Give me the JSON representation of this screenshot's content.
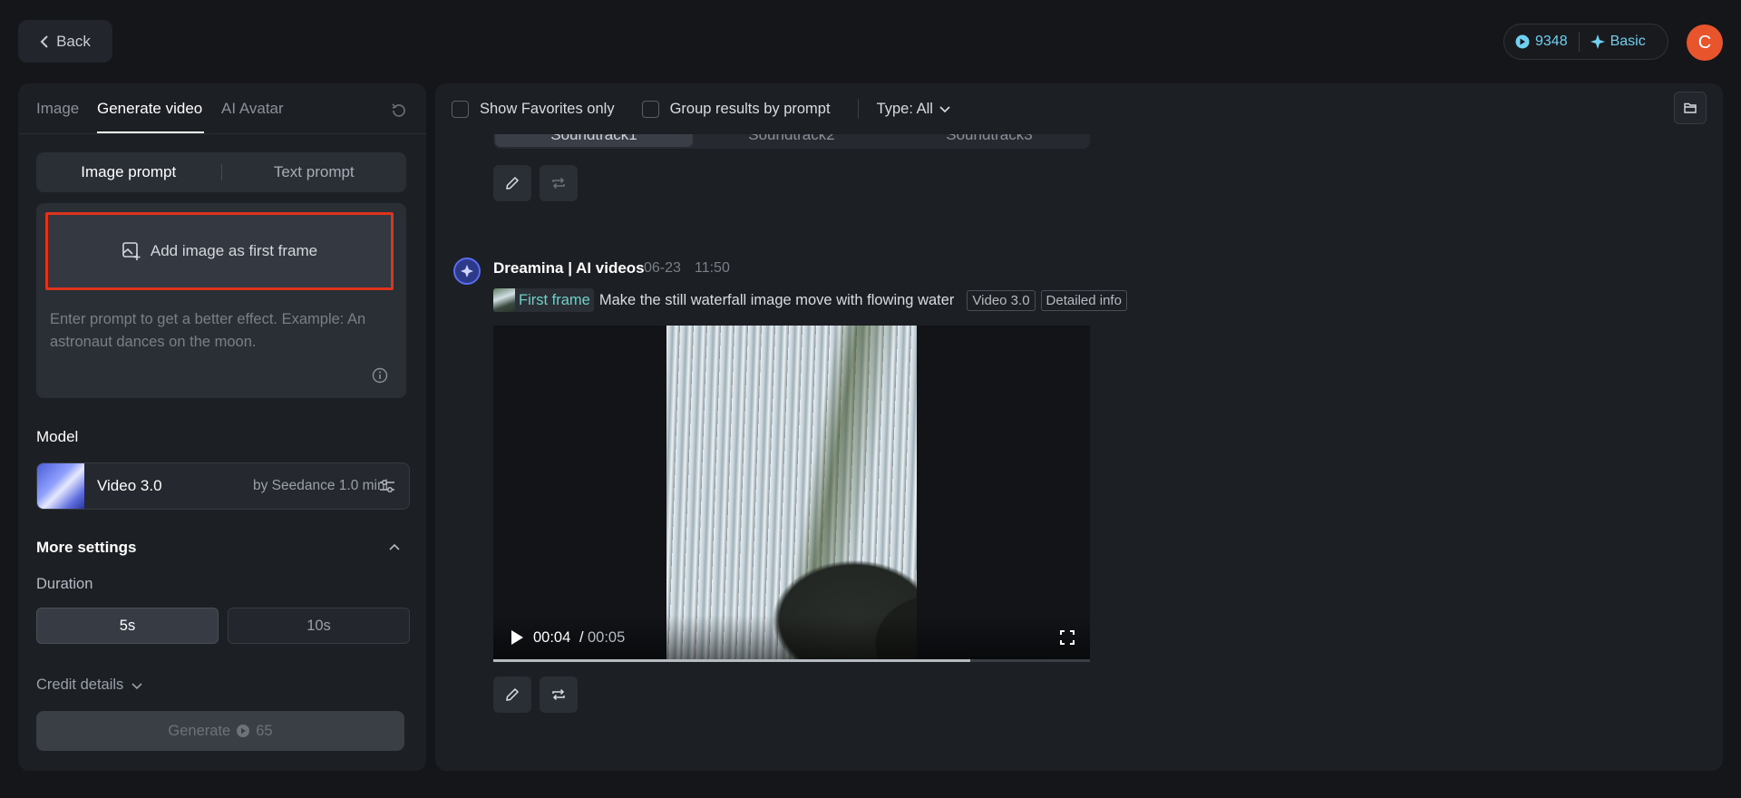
{
  "header": {
    "back_label": "Back",
    "credits": "9348",
    "plan": "Basic",
    "avatar_initial": "C"
  },
  "left_panel": {
    "tabs": [
      {
        "label": "Image"
      },
      {
        "label": "Generate video"
      },
      {
        "label": "AI Avatar"
      }
    ],
    "prompt_modes": [
      {
        "label": "Image prompt"
      },
      {
        "label": "Text prompt"
      }
    ],
    "add_frame_label": "Add image as first frame",
    "prompt_placeholder": "Enter prompt to get a better effect. Example: An astronaut dances on the moon.",
    "model_label": "Model",
    "model": {
      "name": "Video 3.0",
      "by": "by Seedance 1.0 mini"
    },
    "more_settings_label": "More settings",
    "duration_label": "Duration",
    "durations": [
      {
        "label": "5s"
      },
      {
        "label": "10s"
      }
    ],
    "credit_details_label": "Credit details",
    "generate_label": "Generate",
    "generate_cost": "65"
  },
  "right_panel": {
    "filters": {
      "favorites_label": "Show Favorites only",
      "group_label": "Group results by prompt",
      "type_label": "Type: All"
    },
    "soundtracks": [
      {
        "label": "Soundtrack1"
      },
      {
        "label": "Soundtrack2"
      },
      {
        "label": "Soundtrack3"
      }
    ],
    "message": {
      "author": "Dreamina | AI videos",
      "date": "06-23",
      "time": "11:50",
      "frame_chip": "First frame",
      "prompt": "Make the still waterfall image move with flowing water",
      "tags": [
        "Video 3.0",
        "Detailed info"
      ]
    },
    "video": {
      "current_time": "00:04",
      "separator": "/",
      "total_time": "00:05",
      "progress": 0.8
    }
  },
  "colors": {
    "accent_cyan": "#6fd0f0",
    "highlight_red": "#e0331e",
    "avatar_orange": "#e8552d"
  }
}
